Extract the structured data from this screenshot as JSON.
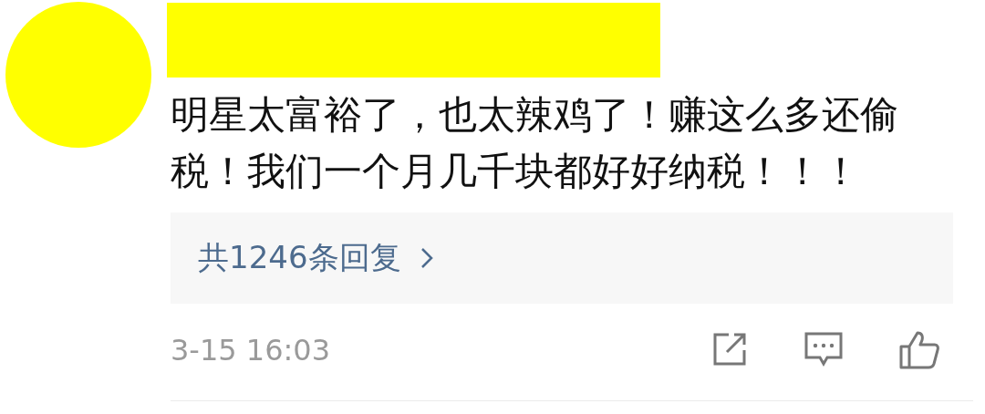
{
  "comment": {
    "text": "明星太富裕了，也太辣鸡了！赚这么多还偷税！我们一个月几千块都好好纳税！！！",
    "replies": "共1246条回复",
    "time": "3-15 16:03"
  }
}
